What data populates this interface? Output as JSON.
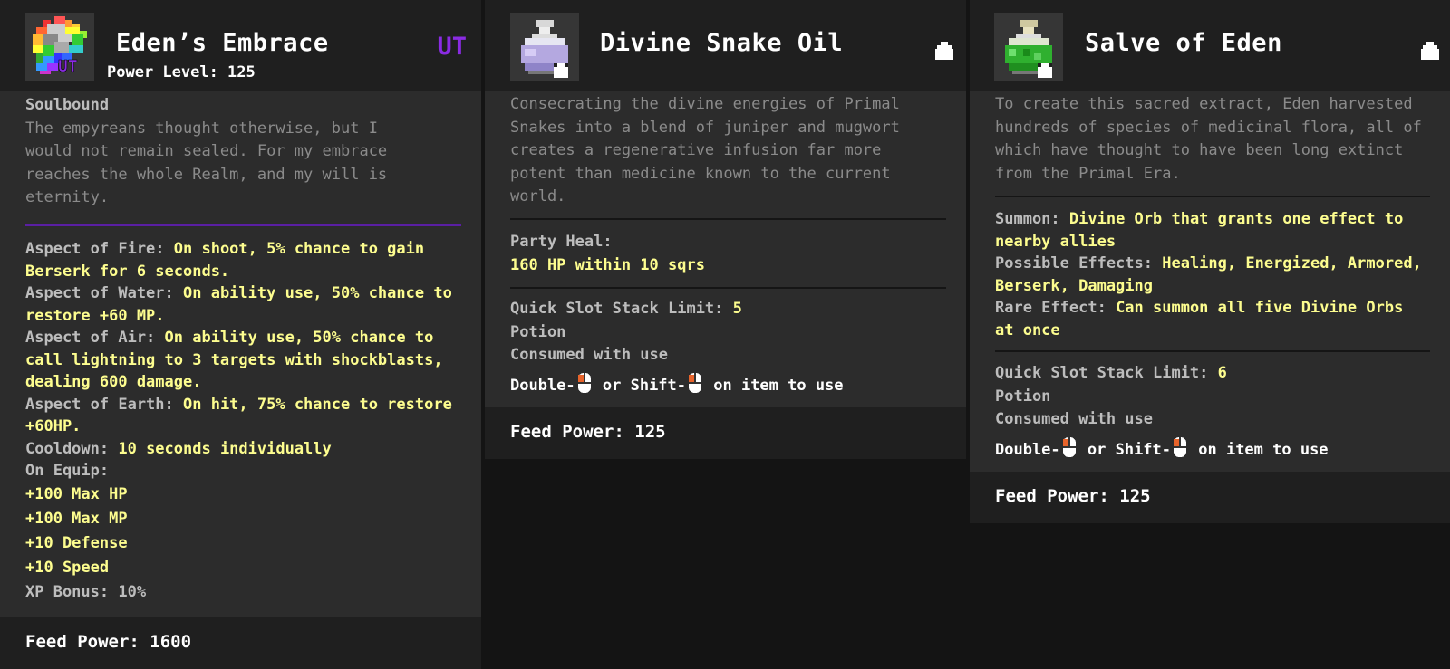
{
  "cards": [
    {
      "title": "Eden’s Embrace",
      "power_level": "Power Level: 125",
      "tier": "UT",
      "icon_letters": "UT",
      "soulbound": "Soulbound",
      "description": [
        "The empyreans thought otherwise, but I",
        "would not remain sealed. For my embrace",
        "reaches the whole Realm, and my will is",
        "eternity."
      ],
      "stats": [
        {
          "label": "Aspect of Fire: ",
          "value": [
            "On shoot, 5% chance to gain",
            "Berserk for 6 seconds."
          ]
        },
        {
          "label": "Aspect of Water: ",
          "value": [
            "On ability use, 50% chance to",
            "restore +60 MP."
          ]
        },
        {
          "label": "Aspect of Air: ",
          "value": [
            "On ability use, 50% chance to",
            "call lightning to 3 targets with shockblasts,",
            "dealing 600 damage."
          ]
        },
        {
          "label": "Aspect of Earth: ",
          "value": [
            "On hit, 75% chance to restore",
            "+60HP."
          ]
        },
        {
          "label": "Cooldown: ",
          "value": [
            "10 seconds individually"
          ]
        }
      ],
      "on_equip_label": "On Equip:",
      "on_equip": [
        "+100 Max HP",
        "+100 Max MP",
        "+10 Defense",
        "+10 Speed"
      ],
      "xp_label": "XP Bonus: ",
      "xp_value": "10%",
      "feed_power": "Feed Power: 1600",
      "accent": "#8a2be2"
    },
    {
      "title": "Divine Snake Oil",
      "description": [
        "Consecrating the divine energies of Primal",
        "Snakes into a blend of  juniper and mugwort",
        "creates a regenerative infusion far more",
        "potent than medicine known to the current",
        "world."
      ],
      "party_heal_label": "Party Heal:",
      "party_heal_value": "160 HP within 10 sqrs",
      "stack_label": "Quick Slot Stack Limit: ",
      "stack_value": "5",
      "type_label": "Potion",
      "consumed_label": "Consumed with use",
      "use_double": "Double-",
      "use_or": " or Shift-",
      "use_rest": " on item to use",
      "feed_power": "Feed Power: 125"
    },
    {
      "title": "Salve of Eden",
      "description": [
        "To create this sacred extract, Eden harvested",
        "hundreds of species of medicinal flora, all of",
        "which have thought to have been long extinct",
        "from the Primal Era."
      ],
      "summon_label": "Summon: ",
      "summon_value": [
        "Divine Orb that grants one effect to",
        "nearby allies"
      ],
      "possible_label": "Possible Effects: ",
      "possible_value": [
        "Healing, Energized, Armored,",
        "Berserk, Damaging"
      ],
      "rare_label": "Rare Effect: ",
      "rare_value": [
        "Can summon all five Divine Orbs",
        "at once"
      ],
      "stack_label": "Quick Slot Stack Limit: ",
      "stack_value": "6",
      "type_label": "Potion",
      "consumed_label": "Consumed with use",
      "use_double": "Double-",
      "use_or": " or Shift-",
      "use_rest": " on item to use",
      "feed_power": "Feed Power: 125"
    }
  ],
  "colors": {
    "panel_bg": "#2c2c2c",
    "header_bg": "#1f1f1f",
    "label": "#bdbdbd",
    "value": "#fdfd8f",
    "description": "#8b8b8b",
    "untiered": "#8a2be2"
  },
  "icons": [
    "rainbow-cloak-icon",
    "lavender-potion-icon",
    "green-potion-icon",
    "soulbound-bag-icon",
    "mouse-icon"
  ]
}
